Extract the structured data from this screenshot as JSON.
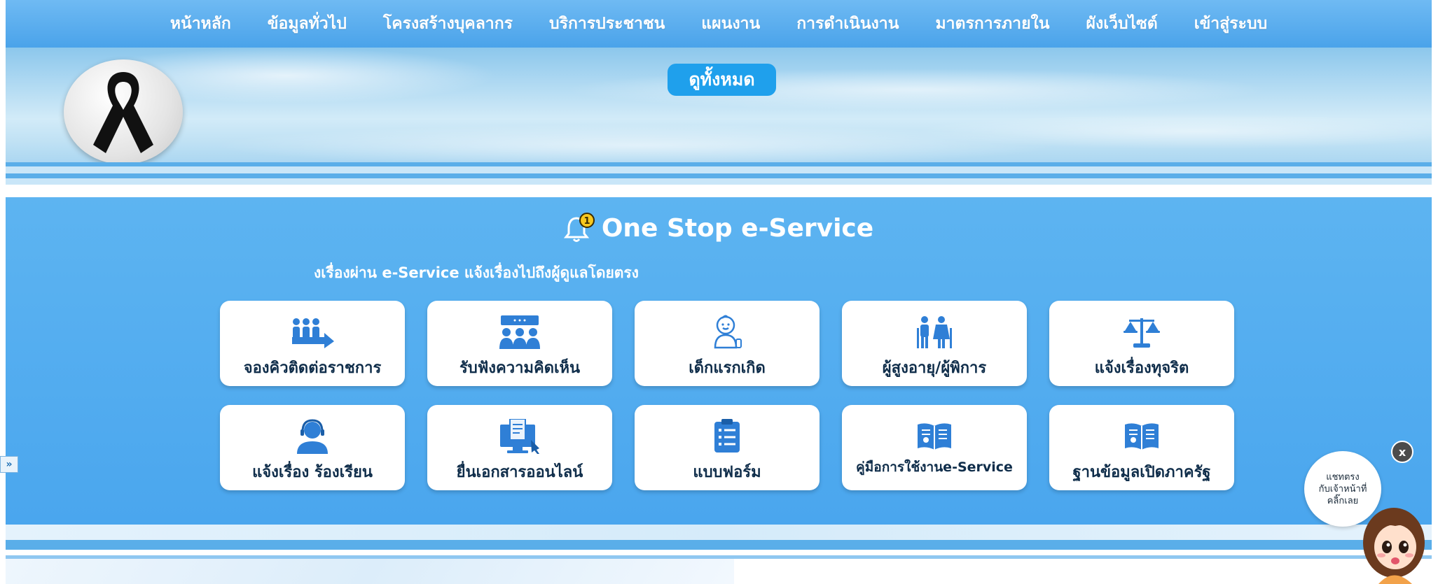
{
  "nav": {
    "items": [
      "หน้าหลัก",
      "ข้อมูลทั่วไป",
      "โครงสร้างบุคลากร",
      "บริการประชาชน",
      "แผนงาน",
      "การดำเนินงาน",
      "มาตรการภายใน",
      "ผังเว็บไซต์",
      "เข้าสู่ระบบ"
    ]
  },
  "hero": {
    "see_all_label": "ดูทั้งหมด"
  },
  "service": {
    "title": "One Stop e-Service",
    "subtitle": "งเรื่องผ่าน e-Service แจ้งเรื่องไปถึงผู้ดูแลโดยตรง",
    "cards": [
      {
        "label": "จองคิวติดต่อราชการ",
        "icon": "queue-people-icon"
      },
      {
        "label": "รับฟังความคิดเห็น",
        "icon": "group-discussion-icon"
      },
      {
        "label": "เด็กแรกเกิด",
        "icon": "baby-icon"
      },
      {
        "label": "ผู้สูงอายุ/ผู้พิการ",
        "icon": "elderly-couple-icon"
      },
      {
        "label": "แจ้งเรื่องทุจริต",
        "icon": "scales-justice-icon"
      },
      {
        "label": "แจ้งเรื่อง ร้องเรียน",
        "icon": "call-center-icon"
      },
      {
        "label": "ยื่นเอกสารออนไลน์",
        "icon": "computer-document-icon"
      },
      {
        "label": "แบบฟอร์ม",
        "icon": "clipboard-form-icon"
      },
      {
        "label": "คู่มือการใช้งานe-Service",
        "icon": "open-book-icon"
      },
      {
        "label": "ฐานข้อมูลเปิดภาครัฐ",
        "icon": "open-book-icon"
      }
    ]
  },
  "chat": {
    "line1": "แชทตรง",
    "line2": "กับเจ้าหน้าที่",
    "line3": "คลิ๊กเลย",
    "close_label": "x"
  },
  "side_tab": {
    "label": "»"
  },
  "colors": {
    "nav_bg": "#4aa3ea",
    "service_bg": "#4aa6ee",
    "button_bg": "#1fa0ec",
    "icon_blue": "#2f7fd6",
    "card_text": "#0f2d4a"
  }
}
